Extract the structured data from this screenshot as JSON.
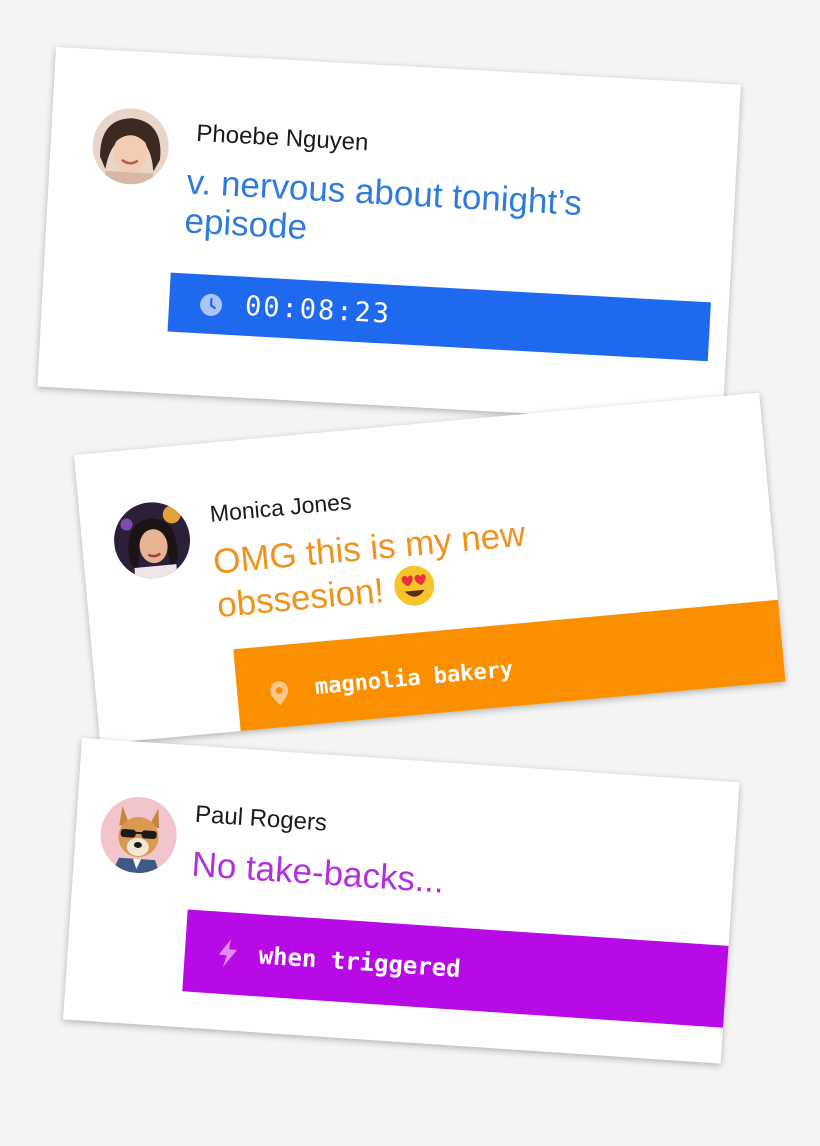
{
  "cards": [
    {
      "name": "Phoebe Nguyen",
      "message": "v. nervous about tonight’s episode",
      "bar_text": "00:08:23",
      "bar_icon": "clock-icon",
      "accent": "#2f7bdc",
      "bar_color": "#1f69ee"
    },
    {
      "name": "Monica Jones",
      "message": "OMG this is my new obssesion!",
      "emoji": "heart-eyes-emoji",
      "bar_text": "magnolia bakery",
      "bar_icon": "location-pin-icon",
      "accent": "#f0921c",
      "bar_color": "#fa8f00"
    },
    {
      "name": "Paul Rogers",
      "message": "No take-backs...",
      "bar_text": "when triggered",
      "bar_icon": "lightning-bolt-icon",
      "accent": "#b22fe0",
      "bar_color": "#b80ae6"
    }
  ]
}
